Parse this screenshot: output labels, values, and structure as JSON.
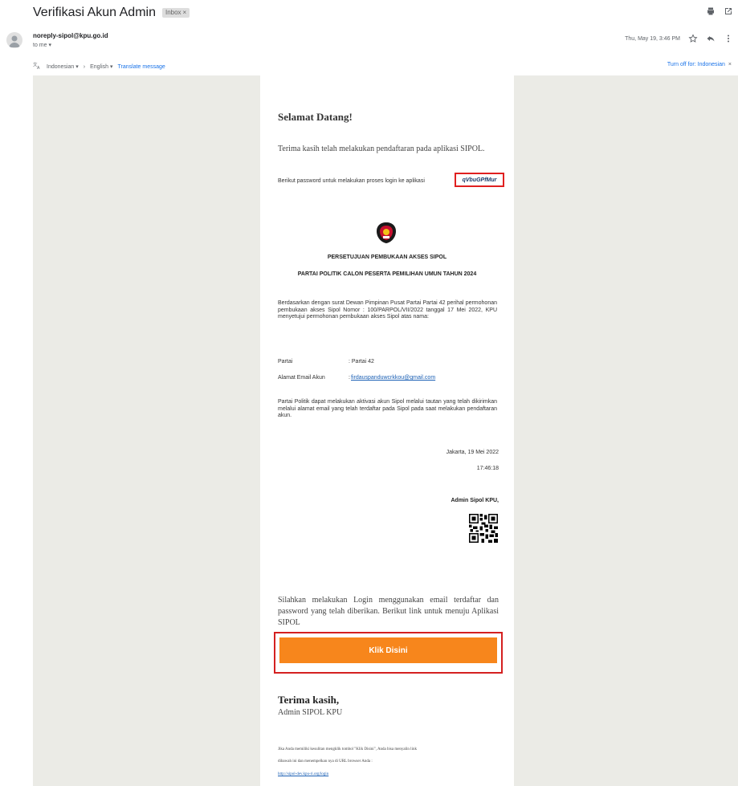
{
  "email": {
    "subject": "Verifikasi Akun Admin",
    "label": "Inbox",
    "label_close": "×",
    "sender": "noreply-sipol@kpu.go.id",
    "recipient": "to me",
    "date": "Thu, May 19, 3:46 PM"
  },
  "translate": {
    "from_lang": "Indonesian",
    "to_lang": "English",
    "translate_link": "Translate message",
    "turn_off": "Turn off for: Indonesian",
    "close": "×"
  },
  "body": {
    "welcome": "Selamat Datang!",
    "thanks_line": "Terima kasih telah melakukan pendaftaran pada aplikasi SIPOL.",
    "password_line": "Berikut password untuk melakukan proses login ke aplikasi",
    "password_value": "qVbuGPfMur",
    "heading1": "PERSETUJUAN PEMBUKAAN AKSES SIPOL",
    "heading2": "PARTAI POLITIK CALON PESERTA PEMILIHAN UMUN TAHUN 2024",
    "paragraph1": "Berdasarkan dengan surat Dewan Pimpinan Pusat Partai Partai 42 perihal permohonan pembukaan akses Sipol Nomor : 100/PARPOL/VII/2022 tanggal 17 Mei 2022, KPU menyetujui permohonan pembukaan akses Sipol atas nama:",
    "fields": [
      {
        "label": "Partai",
        "value": ": Partai 42"
      },
      {
        "label": "Alamat Email Akun",
        "value": ":",
        "link": "firdauspanduwcrkkou@gmail.com"
      }
    ],
    "paragraph2": "Partai Politik dapat melakukan aktivasi akun Sipol melalui tautan yang telah dikirimkan melalui alamat email yang telah terdaftar pada Sipol pada saat melakukan pendaftaran akun.",
    "date": "Jakarta, 19 Mei 2022",
    "time": "17:46:18",
    "admin_title": "Admin Sipol KPU,",
    "login_para": "Silahkan melakukan Login menggunakan email terdaftar dan password yang telah diberikan. Berikut link untuk menuju Aplikasi SIPOL",
    "button_label": "Klik Disini",
    "closing": "Terima kasih,",
    "signature": "Admin SIPOL KPU",
    "footer1": "Jika Anda memiliki kesulitan mengklik tombol \"Klik Disini\", Anda bisa menyalin link",
    "footer2": "dibawah ini dan menempelkan nya di URL browser Anda :",
    "footer_link": "http://sipol-dev.kpu-ri.org/login"
  },
  "colors": {
    "button": "#f7861c",
    "highlight_border": "#e02020",
    "canvas_bg": "#ebebe6"
  }
}
